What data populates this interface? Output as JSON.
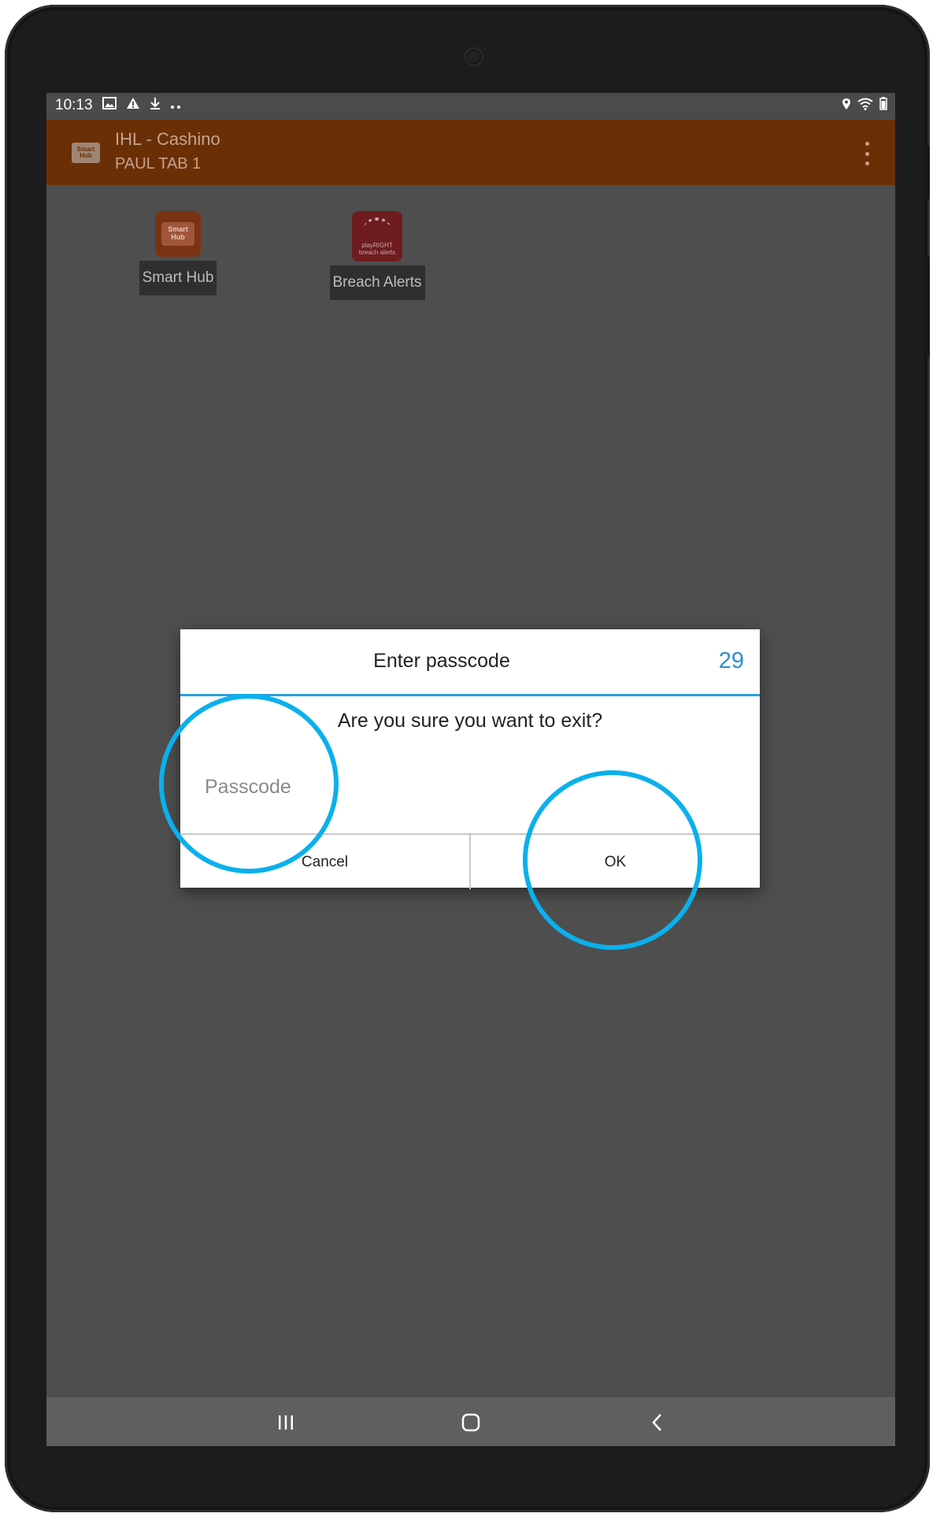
{
  "status_bar": {
    "time": "10:13",
    "left_icons": [
      "image-icon",
      "warning-icon",
      "download-icon",
      "more-notifications-icon"
    ],
    "right_icons": [
      "location-icon",
      "wifi-icon",
      "battery-icon"
    ]
  },
  "app_bar": {
    "logo_text": "Smart Hub",
    "title": "IHL - Cashino",
    "subtitle": "PAUL TAB 1",
    "menu_icon": "overflow-menu-icon",
    "color": "#6b2f05"
  },
  "launcher": [
    {
      "label": "Smart Hub",
      "icon_text": "Smart Hub",
      "icon": "smart-hub-app-icon"
    },
    {
      "label": "Breach Alerts",
      "icon_text": "playRIGHT breach alerts",
      "icon": "breach-alerts-app-icon"
    }
  ],
  "dialog": {
    "title": "Enter passcode",
    "countdown": "29",
    "message": "Are you sure you want to exit?",
    "passcode_placeholder": "Passcode",
    "passcode_value": "",
    "cancel_label": "Cancel",
    "ok_label": "OK",
    "accent_color": "#2aa0dc"
  },
  "annotations": {
    "highlight_color": "#0ab0ec",
    "highlighted": [
      "passcode-input",
      "ok-button"
    ]
  },
  "nav_bar": {
    "icons": [
      "recent-apps-icon",
      "home-icon",
      "back-icon"
    ]
  }
}
